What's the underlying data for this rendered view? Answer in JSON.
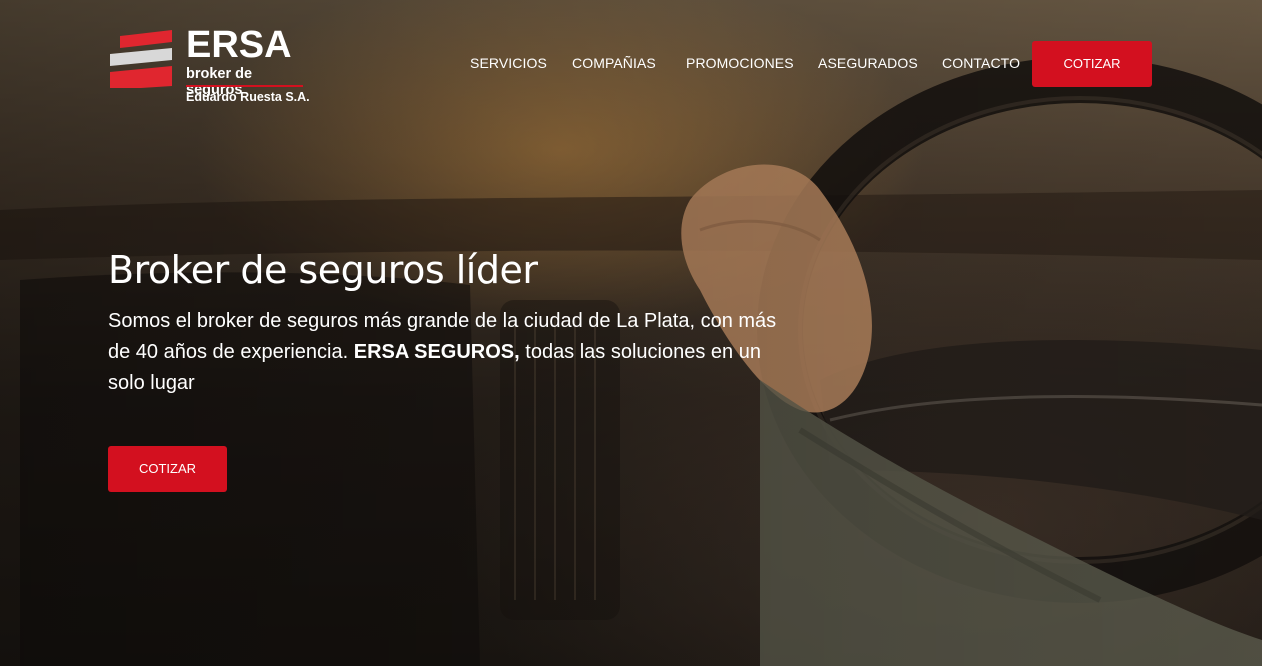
{
  "brand": {
    "name": "ERSA",
    "tagline": "broker de seguros",
    "company": "Eduardo Ruesta S.A.",
    "accent_color": "#d3101f"
  },
  "nav": {
    "items": [
      {
        "label": "SERVICIOS"
      },
      {
        "label": "COMPAÑIAS"
      },
      {
        "label": "PROMOCIONES"
      },
      {
        "label": "ASEGURADOS"
      },
      {
        "label": "CONTACTO"
      }
    ],
    "cta_label": "COTIZAR"
  },
  "hero": {
    "title": "Broker de seguros líder",
    "description_start": "Somos el broker de seguros más grande de la ciudad de La Plata, con más de 40 años de experiencia. ",
    "description_bold": "ERSA SEGUROS,",
    "description_end": " todas las soluciones en un solo lugar",
    "cta_label": "COTIZAR",
    "background_image": "driver-hands-on-steering-wheel"
  }
}
